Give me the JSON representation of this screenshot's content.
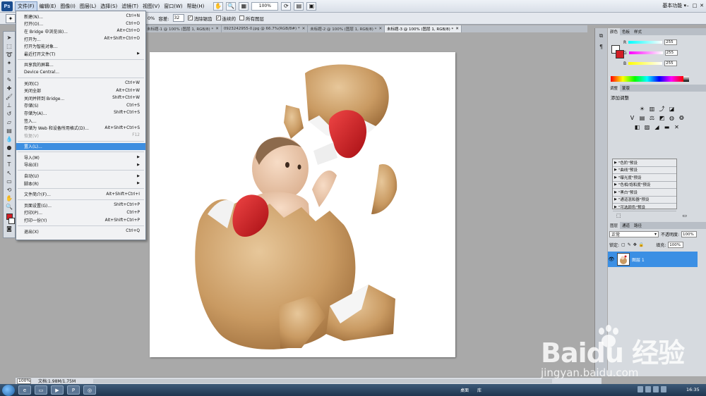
{
  "app": {
    "logo": "Ps"
  },
  "menubar": {
    "items": [
      "文件(F)",
      "编辑(E)",
      "图像(I)",
      "图层(L)",
      "选择(S)",
      "滤镜(T)",
      "视图(V)",
      "窗口(W)",
      "帮助(H)"
    ],
    "zoom": "100%",
    "workspace": "基本功能 ▾",
    "window_controls": [
      "–",
      "□",
      "✕"
    ]
  },
  "options": {
    "pct": "0%",
    "tolerance_label": "容差:",
    "tolerance_value": "32",
    "antialias_label": "消除锯齿",
    "contiguous_label": "连续的",
    "all_layers_label": "所有图层"
  },
  "tabs": [
    {
      "label": "未标题-1 @ 100% (图层 1, RGB/8) *"
    },
    {
      "label": "0923242955-0.jpg @ 66.7%(RGB/8#) *"
    },
    {
      "label": "未标题-2 @ 100% (图层 1, RGB/8) *"
    },
    {
      "label": "未标题-3 @ 100% (图层 1, RGB/8) *"
    }
  ],
  "filemenu": {
    "items": [
      {
        "label": "新建(N)...",
        "shortcut": "Ctrl+N",
        "type": "item"
      },
      {
        "label": "打开(O)...",
        "shortcut": "Ctrl+O",
        "type": "item"
      },
      {
        "label": "在 Bridge 中浏览(B)...",
        "shortcut": "Alt+Ctrl+O",
        "type": "item"
      },
      {
        "label": "打开为...",
        "shortcut": "Alt+Shift+Ctrl+O",
        "type": "item"
      },
      {
        "label": "打开为智能对象...",
        "shortcut": "",
        "type": "item"
      },
      {
        "label": "最近打开文件(T)",
        "shortcut": "▶",
        "type": "submenu"
      },
      {
        "type": "sep"
      },
      {
        "label": "共享我的屏幕...",
        "shortcut": "",
        "type": "item"
      },
      {
        "label": "Device Central...",
        "shortcut": "",
        "type": "item"
      },
      {
        "type": "sep"
      },
      {
        "label": "关闭(C)",
        "shortcut": "Ctrl+W",
        "type": "item"
      },
      {
        "label": "关闭全部",
        "shortcut": "Alt+Ctrl+W",
        "type": "item"
      },
      {
        "label": "关闭并转到 Bridge...",
        "shortcut": "Shift+Ctrl+W",
        "type": "item"
      },
      {
        "label": "存储(S)",
        "shortcut": "Ctrl+S",
        "type": "item"
      },
      {
        "label": "存储为(A)...",
        "shortcut": "Shift+Ctrl+S",
        "type": "item"
      },
      {
        "label": "签入...",
        "shortcut": "",
        "type": "item"
      },
      {
        "label": "存储为 Web 和设备所用格式(D)...",
        "shortcut": "Alt+Shift+Ctrl+S",
        "type": "item"
      },
      {
        "label": "恢复(V)",
        "shortcut": "F12",
        "type": "disabled"
      },
      {
        "type": "sep"
      },
      {
        "label": "置入(L)...",
        "shortcut": "",
        "type": "highlight"
      },
      {
        "type": "sep"
      },
      {
        "label": "导入(M)",
        "shortcut": "▶",
        "type": "submenu"
      },
      {
        "label": "导出(E)",
        "shortcut": "▶",
        "type": "submenu"
      },
      {
        "type": "sep"
      },
      {
        "label": "自动(U)",
        "shortcut": "▶",
        "type": "submenu"
      },
      {
        "label": "脚本(R)",
        "shortcut": "▶",
        "type": "submenu"
      },
      {
        "type": "sep"
      },
      {
        "label": "文件简介(F)...",
        "shortcut": "Alt+Shift+Ctrl+I",
        "type": "item"
      },
      {
        "type": "sep"
      },
      {
        "label": "页面设置(G)...",
        "shortcut": "Shift+Ctrl+P",
        "type": "item"
      },
      {
        "label": "打印(P)...",
        "shortcut": "Ctrl+P",
        "type": "item"
      },
      {
        "label": "打印一份(Y)",
        "shortcut": "Alt+Shift+Ctrl+P",
        "type": "item"
      },
      {
        "type": "sep"
      },
      {
        "label": "退出(X)",
        "shortcut": "Ctrl+Q",
        "type": "item"
      }
    ]
  },
  "status": {
    "zoom": "100%",
    "doc": "文档:1.98M/1.75M"
  },
  "color_panel": {
    "tabs": [
      "颜色",
      "色板",
      "样式"
    ],
    "channels": [
      {
        "name": "R",
        "value": "255",
        "gradient": [
          "#00ffff",
          "#ffffff"
        ]
      },
      {
        "name": "G",
        "value": "255",
        "gradient": [
          "#ff00ff",
          "#ffffff"
        ]
      },
      {
        "name": "B",
        "value": "255",
        "gradient": [
          "#ffff00",
          "#ffffff"
        ]
      }
    ]
  },
  "adjust_panel": {
    "tabs": [
      "调整",
      "蒙版"
    ],
    "title": "添加调整",
    "presets": [
      "\"色阶\"预设",
      "\"曲线\"预设",
      "\"曝光度\"预设",
      "\"色相/饱和度\"预设",
      "\"黑白\"预设",
      "\"通道混和器\"预设",
      "\"可选颜色\"预设"
    ]
  },
  "layers_panel": {
    "tabs": [
      "图层",
      "通道",
      "路径"
    ],
    "blend_mode": "正常",
    "opacity_label": "不透明度:",
    "opacity": "100%",
    "lock_label": "锁定:",
    "fill_label": "填充:",
    "fill": "100%",
    "layers": [
      {
        "name": "图层 1"
      }
    ]
  },
  "taskbar": {
    "desktop": "桌面",
    "library": "库",
    "time": "16:35"
  },
  "watermark": {
    "brand": "Baidu 经验",
    "url": "jingyan.baidu.com"
  }
}
